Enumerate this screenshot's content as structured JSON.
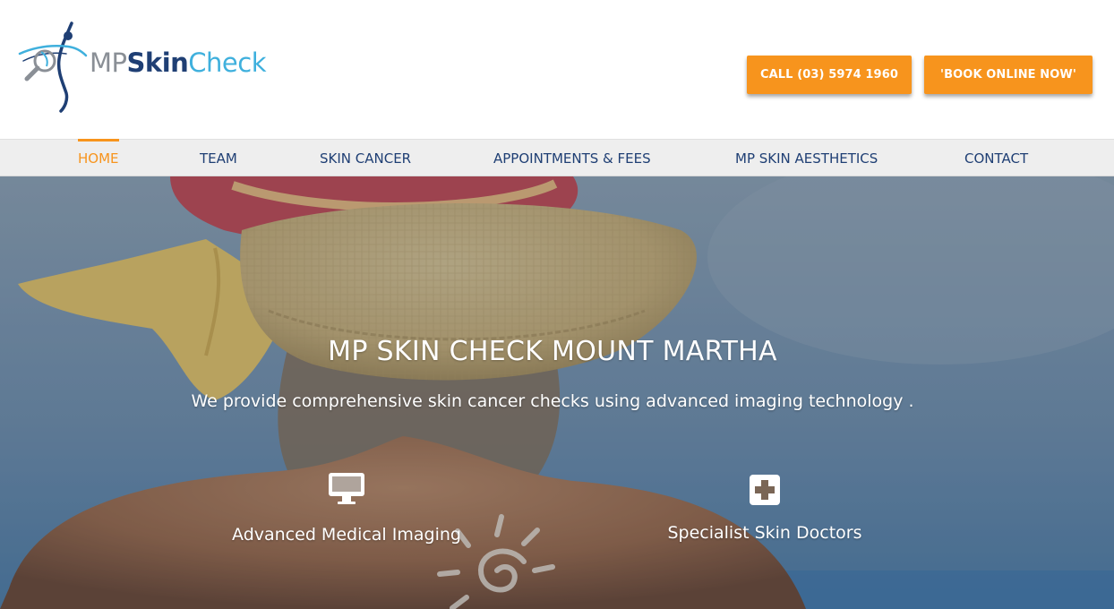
{
  "brand": {
    "prefix": "MP",
    "mid": "Skin",
    "suffix": "Check",
    "colors": {
      "prefix": "#8a8f96",
      "mid": "#1f3f74",
      "suffix": "#3fb0dd"
    }
  },
  "header": {
    "call_label": "CALL (03) 5974 1960",
    "book_label": "'BOOK ONLINE NOW'",
    "button_color": "#f7941d"
  },
  "nav": {
    "items": [
      {
        "label": "HOME",
        "active": true
      },
      {
        "label": "TEAM",
        "active": false
      },
      {
        "label": "SKIN CANCER",
        "active": false
      },
      {
        "label": "APPOINTMENTS & FEES",
        "active": false
      },
      {
        "label": "MP SKIN AESTHETICS",
        "active": false
      },
      {
        "label": "CONTACT",
        "active": false
      }
    ],
    "active_color": "#f7941d",
    "text_color": "#1f3f74"
  },
  "hero": {
    "title": "MP SKIN CHECK MOUNT MARTHA",
    "subtitle": "We provide comprehensive skin cancer checks using advanced imaging technology .",
    "features": [
      {
        "label": "Advanced Medical Imaging",
        "icon": "desktop-monitor-icon"
      },
      {
        "label": "Specialist Skin Doctors",
        "icon": "medical-plus-icon"
      }
    ]
  }
}
